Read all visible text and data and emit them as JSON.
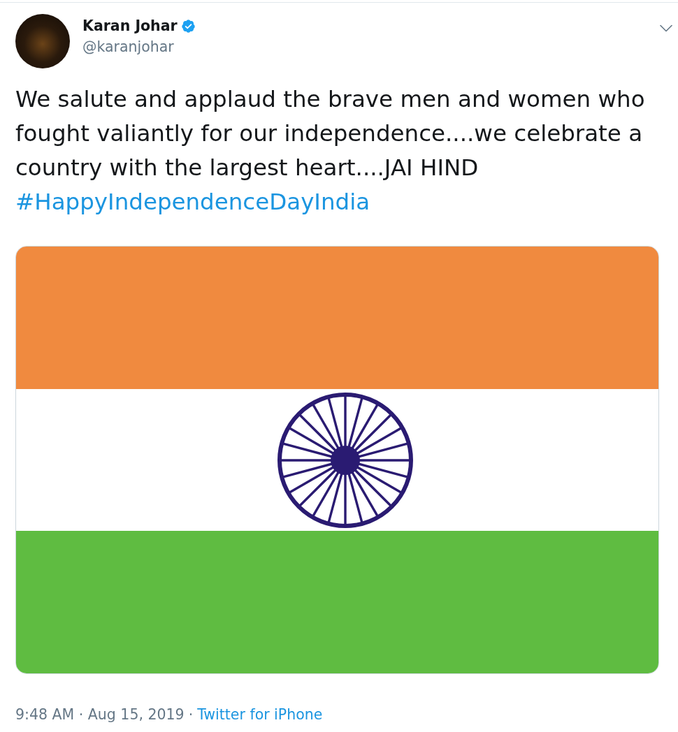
{
  "tweet": {
    "author": {
      "name": "Karan Johar",
      "verified": true,
      "handle": "@karanjohar"
    },
    "text": "We salute and applaud the brave men and women who fought valiantly for our independence....we celebrate a country with the largest heart....JAI HIND",
    "hashtags": [
      "#HappyIndependenceDayIndia"
    ],
    "media": {
      "kind": "flag",
      "stripes": [
        {
          "color": "#f08a3f"
        },
        {
          "color": "#ffffff"
        },
        {
          "color": "#5fbc41"
        }
      ]
    },
    "timestamp": "9:48 AM · Aug 15, 2019",
    "separator": "·",
    "source": "Twitter for iPhone"
  }
}
